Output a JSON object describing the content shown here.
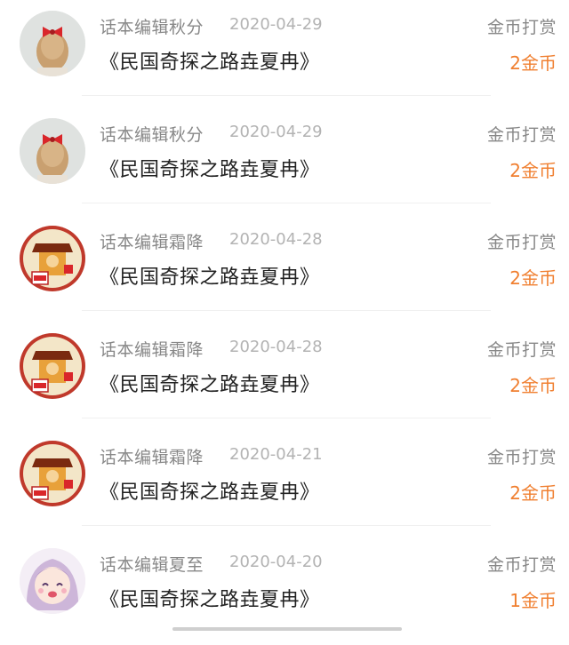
{
  "records": [
    {
      "user": "话本编辑秋分",
      "date": "2020-04-29",
      "book": "《民国奇探之路垚夏冉》",
      "action": "金币打赏",
      "amount": "2金币",
      "avatar": "bow-girl-avatar"
    },
    {
      "user": "话本编辑秋分",
      "date": "2020-04-29",
      "book": "《民国奇探之路垚夏冉》",
      "action": "金币打赏",
      "amount": "2金币",
      "avatar": "bow-girl-avatar"
    },
    {
      "user": "话本编辑霜降",
      "date": "2020-04-28",
      "book": "《民国奇探之路垚夏冉》",
      "action": "金币打赏",
      "amount": "2金币",
      "avatar": "detective-avatar"
    },
    {
      "user": "话本编辑霜降",
      "date": "2020-04-28",
      "book": "《民国奇探之路垚夏冉》",
      "action": "金币打赏",
      "amount": "2金币",
      "avatar": "detective-avatar"
    },
    {
      "user": "话本编辑霜降",
      "date": "2020-04-21",
      "book": "《民国奇探之路垚夏冉》",
      "action": "金币打赏",
      "amount": "2金币",
      "avatar": "detective-avatar"
    },
    {
      "user": "话本编辑夏至",
      "date": "2020-04-20",
      "book": "《民国奇探之路垚夏冉》",
      "action": "金币打赏",
      "amount": "1金币",
      "avatar": "anime-girl-avatar"
    }
  ],
  "colors": {
    "amount": "#f07f30",
    "secondary": "#888888",
    "title": "#222222"
  }
}
